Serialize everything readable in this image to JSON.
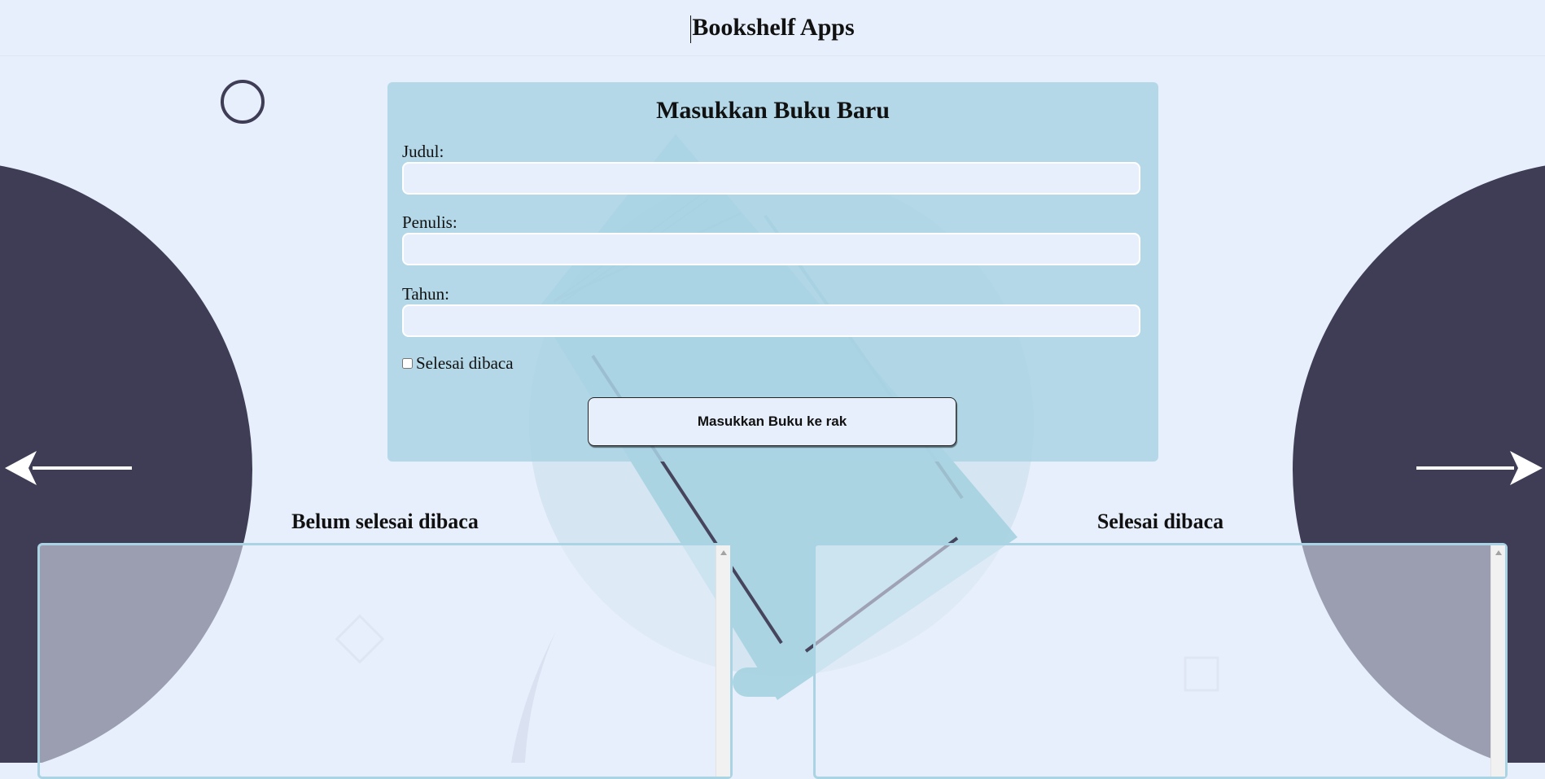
{
  "header": {
    "title": "Bookshelf Apps"
  },
  "form": {
    "title": "Masukkan Buku Baru",
    "title_label": "Judul:",
    "title_value": "",
    "author_label": "Penulis:",
    "author_value": "",
    "year_label": "Tahun:",
    "year_value": "",
    "complete_label": "Selesai dibaca",
    "complete_checked": false,
    "submit_label": "Masukkan Buku ke rak"
  },
  "shelves": {
    "incomplete_title": "Belum selesai dibaca",
    "complete_title": "Selesai dibaca"
  },
  "colors": {
    "background": "#e8effc",
    "form_panel": "#aad4e4",
    "dark_accent": "#3f3d56",
    "shelf_border": "#aad4e4"
  },
  "icons": {
    "left": "arrow-left-icon",
    "right": "arrow-right-icon",
    "circle": "circle-outline-icon",
    "diamond": "diamond-outline-icon",
    "square": "square-outline-icon"
  }
}
